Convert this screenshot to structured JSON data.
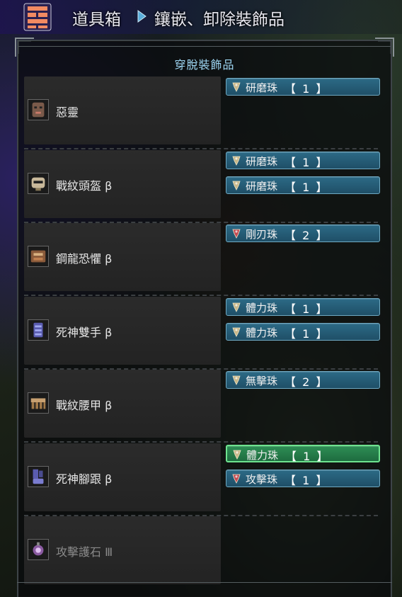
{
  "header": {
    "breadcrumb_1": "道具箱",
    "breadcrumb_2": "鑲嵌、卸除裝飾品"
  },
  "panel": {
    "title": "穿脫裝飾品"
  },
  "rows": [
    {
      "name": "惡靈",
      "icon": "helmet-mask-icon",
      "dim": false,
      "decos": [
        {
          "name": "研磨珠",
          "level": "【 1 】",
          "color": "#c9b88a"
        }
      ]
    },
    {
      "name": "戰紋頭盔 β",
      "icon": "helmet-icon",
      "dim": false,
      "decos": [
        {
          "name": "研磨珠",
          "level": "【 1 】",
          "color": "#c9b88a"
        },
        {
          "name": "研磨珠",
          "level": "【 1 】",
          "color": "#c9b88a"
        }
      ]
    },
    {
      "name": "鋼龍恐懼 β",
      "icon": "chest-armor-icon",
      "dim": false,
      "decos": [
        {
          "name": "剛刃珠",
          "level": "【 2 】",
          "color": "#c44a52"
        }
      ]
    },
    {
      "name": "死神雙手 β",
      "icon": "arm-armor-icon",
      "dim": false,
      "decos": [
        {
          "name": "體力珠",
          "level": "【 1 】",
          "color": "#c9b88a"
        },
        {
          "name": "體力珠",
          "level": "【 1 】",
          "color": "#c9b88a"
        }
      ]
    },
    {
      "name": "戰紋腰甲 β",
      "icon": "waist-armor-icon",
      "dim": false,
      "decos": [
        {
          "name": "無擊珠",
          "level": "【 2 】",
          "color": "#c9b88a"
        }
      ]
    },
    {
      "name": "死神腳跟 β",
      "icon": "leg-armor-icon",
      "dim": false,
      "decos": [
        {
          "name": "體力珠",
          "level": "【 1 】",
          "color": "#c9b88a",
          "active": true
        },
        {
          "name": "攻擊珠",
          "level": "【 1 】",
          "color": "#c44a52"
        }
      ]
    },
    {
      "name": "攻擊護石 Ⅲ",
      "icon": "charm-icon",
      "dim": true,
      "decos": []
    }
  ]
}
